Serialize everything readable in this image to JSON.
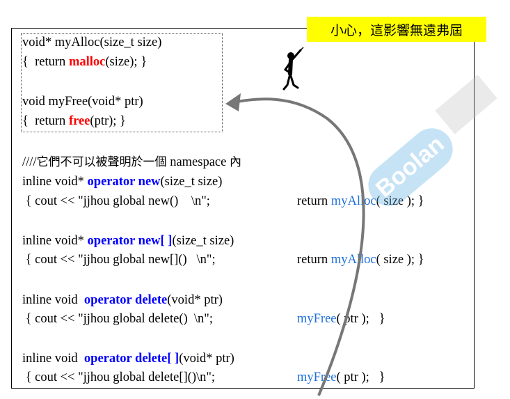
{
  "callout": {
    "text": "小心，這影響無遠弗屆"
  },
  "alloc_box": {
    "line1": "void* myAlloc(size_t size)",
    "line2_prefix": "{  return ",
    "line2_kw": "malloc",
    "line2_suffix": "(size); }",
    "line3": "void myFree(void* ptr)",
    "line4_prefix": "{  return ",
    "line4_kw": "free",
    "line4_suffix": "(ptr); }"
  },
  "note": {
    "prefix": "////",
    "cjk1": "它們不可以被聲明於一個",
    "mid": " namespace ",
    "cjk2": "內"
  },
  "ops": [
    {
      "head_prefix": "inline void* ",
      "head_kw": "operator new",
      "head_suffix": "(size_t size)",
      "body": " { cout << \"jjhou global new()    \\n\";",
      "ret_prefix": "return ",
      "ret_fn": "myAlloc",
      "ret_suffix": "( size ); }"
    },
    {
      "head_prefix": "inline void* ",
      "head_kw": "operator new[ ]",
      "head_suffix": "(size_t size)",
      "body": " { cout << \"jjhou global new[]()   \\n\";",
      "ret_prefix": "return ",
      "ret_fn": "myAlloc",
      "ret_suffix": "( size ); }"
    },
    {
      "head_prefix": "inline void  ",
      "head_kw": "operator delete",
      "head_suffix": "(void* ptr)",
      "body": " { cout << \"jjhou global delete()  \\n\";",
      "ret_prefix": "",
      "ret_fn": "myFree",
      "ret_suffix": "( ptr );   }"
    },
    {
      "head_prefix": "inline void  ",
      "head_kw": "operator delete[ ]",
      "head_suffix": "(void* ptr)",
      "body": " { cout << \"jjhou global delete[]()\\n\";",
      "ret_prefix": "",
      "ret_fn": "myFree",
      "ret_suffix": "( ptr );   }"
    }
  ],
  "colors": {
    "keyword_red": "#ff0000",
    "keyword_blue": "#0000ff",
    "function_blue": "#1e6fd9",
    "callout_bg": "#ffff00",
    "arrow": "#777777"
  }
}
